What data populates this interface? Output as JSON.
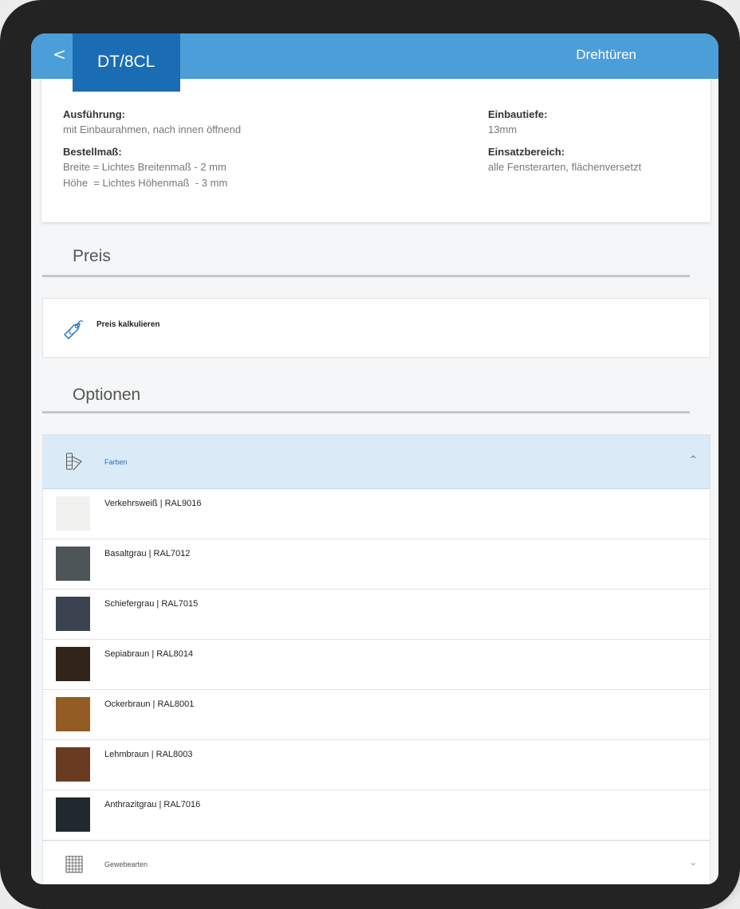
{
  "header": {
    "back_label": "<",
    "product_code": "DT/8CL",
    "category": "Drehtüren"
  },
  "info": {
    "left": {
      "label1": "Ausführung:",
      "value1": "mit Einbaurahmen, nach innen öffnend",
      "label2": "Bestellmaß:",
      "value2a": "Breite = Lichtes Breitenmaß - 2 mm",
      "value2b": "Höhe  = Lichtes Höhenmaß  - 3 mm"
    },
    "right": {
      "label1": "Einbautiefe:",
      "value1": "13mm",
      "label2": "Einsatzbereich:",
      "value2": "alle Fensterarten, flächenversetzt"
    }
  },
  "price": {
    "section_title": "Preis",
    "action_label": "Preis kalkulieren",
    "icon": "price-tag-euro-icon"
  },
  "options": {
    "section_title": "Optionen",
    "colors": {
      "title": "Farben",
      "icon": "color-palette-icon",
      "expanded": true,
      "items": [
        {
          "label": "Verkehrsweiß | RAL9016",
          "color": "#f1f1ef"
        },
        {
          "label": "Basaltgrau | RAL7012",
          "color": "#4e5556"
        },
        {
          "label": "Schiefergrau | RAL7015",
          "color": "#3c4350"
        },
        {
          "label": "Sepiabraun | RAL8014",
          "color": "#312519"
        },
        {
          "label": "Ockerbraun | RAL8001",
          "color": "#935c25"
        },
        {
          "label": "Lehmbraun | RAL8003",
          "color": "#693b20"
        },
        {
          "label": "Anthrazitgrau | RAL7016",
          "color": "#1f292e"
        }
      ]
    },
    "mesh": {
      "title": "Gewebearten",
      "icon": "mesh-grid-icon",
      "expanded": false
    }
  },
  "theme": {
    "header_bg": "#4b9ed8",
    "tab_bg": "#1a6db3",
    "options_header_bg": "#daeaf6"
  }
}
